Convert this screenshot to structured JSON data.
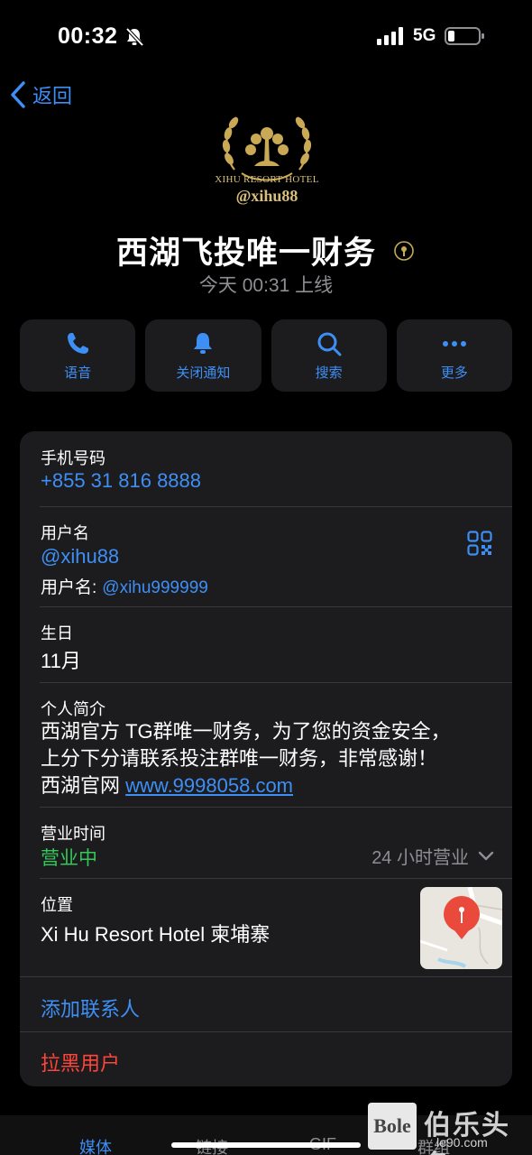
{
  "status_bar": {
    "time": "00:32",
    "network": "5G"
  },
  "nav": {
    "back_label": "返回"
  },
  "profile": {
    "logo_line1": "XIHU RESORT HOTEL",
    "logo_line2": "@xihu88",
    "name": "西湖飞投唯一财务",
    "presence": "今天 00:31 上线"
  },
  "actions": [
    {
      "label": "语音",
      "icon": "phone-icon"
    },
    {
      "label": "关闭通知",
      "icon": "bell-icon"
    },
    {
      "label": "搜索",
      "icon": "search-icon"
    },
    {
      "label": "更多",
      "icon": "more-icon"
    }
  ],
  "info": {
    "phone_label": "手机号码",
    "phone_value": "+855 31 816 8888",
    "username_label": "用户名",
    "username_value": "@xihu88",
    "username2_prefix": "用户名:",
    "username2_value": "@xihu999999",
    "birthday_label": "生日",
    "birthday_value": "11月",
    "bio_label": "个人简介",
    "bio_line1": "西湖官方 TG群唯一财务，为了您的资金安全，",
    "bio_line2": "上分下分请联系投注群唯一财务，非常感谢！",
    "bio_line3_prefix": "西湖官网 ",
    "bio_link": "www.9998058.com",
    "hours_label": "营业时间",
    "hours_status": "营业中",
    "hours_detail": "24 小时营业",
    "location_label": "位置",
    "location_value": "Xi Hu Resort Hotel  柬埔寨",
    "add_contact": "添加联系人",
    "block_user": "拉黑用户"
  },
  "tabs": [
    {
      "label": "媒体",
      "active": true
    },
    {
      "label": "链接",
      "active": false
    },
    {
      "label": "GIF",
      "active": false
    },
    {
      "label": "群组",
      "active": false
    }
  ],
  "watermark": {
    "box": "Bole",
    "title": "伯乐头条",
    "url": "le90.com"
  },
  "colors": {
    "accent": "#3e8ff5",
    "open": "#34c759",
    "danger": "#ff453a",
    "card": "#1c1c1e",
    "gold": "#d9c07a"
  }
}
